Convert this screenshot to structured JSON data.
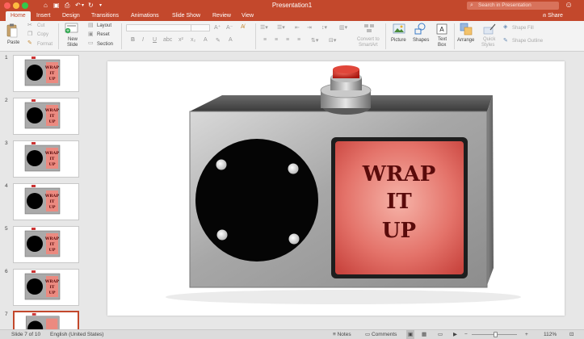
{
  "window": {
    "title": "Presentation1"
  },
  "search": {
    "placeholder": "Search in Presentation"
  },
  "tabs": [
    "Home",
    "Insert",
    "Design",
    "Transitions",
    "Animations",
    "Slide Show",
    "Review",
    "View"
  ],
  "share_label": "Share",
  "ribbon": {
    "paste": "Paste",
    "cut": "Cut",
    "copy": "Copy",
    "format": "Format",
    "new_slide_1": "New",
    "new_slide_2": "Slide",
    "layout": "Layout",
    "reset": "Reset",
    "section": "Section",
    "convert_1": "Convert to",
    "convert_2": "SmartArt",
    "picture": "Picture",
    "shapes": "Shapes",
    "textbox_1": "Text",
    "textbox_2": "Box",
    "arrange": "Arrange",
    "quick_1": "Quick",
    "quick_2": "Styles",
    "shape_fill": "Shape Fill",
    "shape_outline": "Shape Outline"
  },
  "slides": [
    {
      "num": "1"
    },
    {
      "num": "2"
    },
    {
      "num": "3"
    },
    {
      "num": "4"
    },
    {
      "num": "5"
    },
    {
      "num": "6"
    },
    {
      "num": "7"
    }
  ],
  "selected_slide": 7,
  "main_slide": {
    "word1": "WRAP",
    "word2": "IT",
    "word3": "UP"
  },
  "thumb_text": {
    "w1": "WRAP",
    "w2": "IT",
    "w3": "UP"
  },
  "status": {
    "slide": "Slide 7 of 10",
    "language": "English (United States)",
    "notes": "Notes",
    "comments": "Comments",
    "zoom": "112%"
  },
  "colors": {
    "accent": "#c3482c",
    "panel_red": "#e66a5e",
    "button_red": "#d62e22"
  }
}
